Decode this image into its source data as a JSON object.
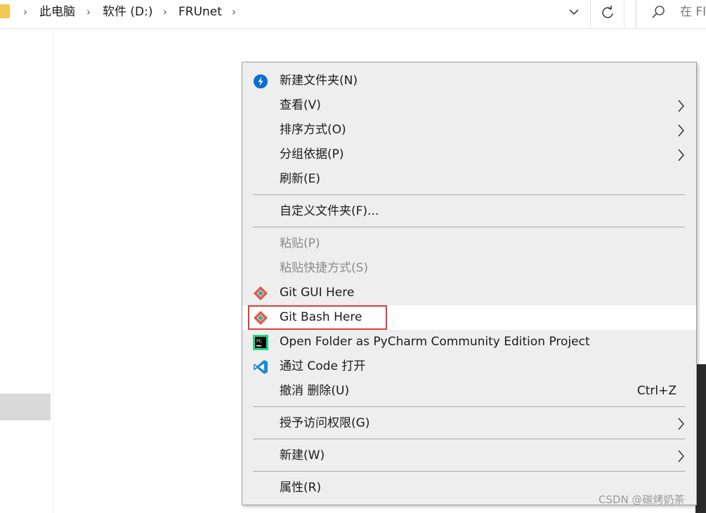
{
  "address_bar": {
    "breadcrumbs": [
      "此电脑",
      "软件 (D:)",
      "FRUnet"
    ],
    "separator": "›",
    "search_placeholder": "在 FI"
  },
  "context_menu": {
    "items": [
      {
        "label": "新建文件夹(N)",
        "icon": "new-folder-icon"
      },
      {
        "label": "查看(V)",
        "submenu": true
      },
      {
        "label": "排序方式(O)",
        "submenu": true
      },
      {
        "label": "分组依据(P)",
        "submenu": true
      },
      {
        "label": "刷新(E)"
      },
      {
        "label": "自定义文件夹(F)..."
      },
      {
        "label": "粘贴(P)",
        "disabled": true
      },
      {
        "label": "粘贴快捷方式(S)",
        "disabled": true
      },
      {
        "label": "Git GUI Here",
        "icon": "git-icon"
      },
      {
        "label": "Git Bash Here",
        "icon": "git-icon",
        "highlighted": true
      },
      {
        "label": "Open Folder as PyCharm Community Edition Project",
        "icon": "pycharm-icon"
      },
      {
        "label": "通过 Code 打开",
        "icon": "vscode-icon"
      },
      {
        "label": "撤消 删除(U)",
        "shortcut": "Ctrl+Z"
      },
      {
        "label": "授予访问权限(G)",
        "submenu": true
      },
      {
        "label": "新建(W)",
        "submenu": true
      },
      {
        "label": "属性(R)"
      }
    ]
  },
  "watermark": "CSDN @碳烤奶茶",
  "colors": {
    "menu_bg": "#eeeeee",
    "highlight_bg": "#ffffff",
    "highlight_border": "#e03b3b",
    "disabled_text": "#8c8c8c",
    "folder_yellow": "#f3c752",
    "nav_selection": "#d9d9d9"
  }
}
